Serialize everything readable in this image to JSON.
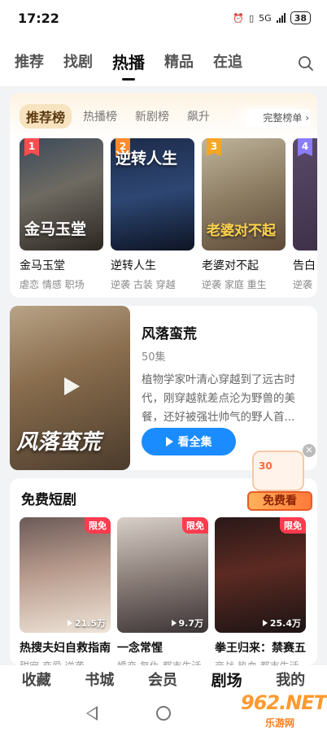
{
  "status_bar": {
    "time": "17:22",
    "network": "5G",
    "battery": "38"
  },
  "top_tabs": [
    {
      "label": "推荐",
      "active": false
    },
    {
      "label": "找剧",
      "active": false
    },
    {
      "label": "热播",
      "active": true
    },
    {
      "label": "精品",
      "active": false
    },
    {
      "label": "在追",
      "active": false
    }
  ],
  "ranking": {
    "title": "推荐榜",
    "subtabs": [
      "热播榜",
      "新剧榜",
      "飙升"
    ],
    "more": "完整榜单",
    "items": [
      {
        "rank": "1",
        "poster_text": "金马玉堂",
        "name": "金马玉堂",
        "tags": "虐恋 情感 职场",
        "badge_color": "#ff4d4f",
        "poster_bg": "linear-gradient(160deg,#3c4a5a 0%,#6e6a62 45%,#2c2620 100%)"
      },
      {
        "rank": "2",
        "poster_text": "逆转人生",
        "name": "逆转人生",
        "tags": "逆袭 古装 穿越",
        "badge_color": "#ff8a2a",
        "poster_bg": "linear-gradient(170deg,#1d2b4a 0%,#2d4773 50%,#0e1424 100%)"
      },
      {
        "rank": "3",
        "poster_text": "老婆对不起",
        "name": "老婆对不起",
        "tags": "逆袭 家庭 重生",
        "badge_color": "#f5a623",
        "poster_bg": "linear-gradient(160deg,#bfb59c 0%,#8c7c62 50%,#5d4a38 100%)"
      },
      {
        "rank": "4",
        "poster_text": "",
        "name": "告白",
        "tags": "逆袭",
        "badge_color": "#8a7cff",
        "poster_bg": "linear-gradient(160deg,#5a4a6a 0%,#3a2c44 100%)"
      }
    ]
  },
  "featured": {
    "poster_text": "风落蛮荒",
    "title": "风落蛮荒",
    "episodes": "50集",
    "description": "植物学家叶清心穿越到了远古时代，刚穿越就差点沦为野兽的美餐，还好被强壮帅气的野人首...",
    "button": "看全集"
  },
  "promo": {
    "amount": "30",
    "label": "免费看"
  },
  "free_section": {
    "title": "免费短剧",
    "items": [
      {
        "badge": "限免",
        "views": "21.5万",
        "name": "热搜夫妇自救指南",
        "sub": "甜宠 恋爱 逆袭",
        "poster_bg": "linear-gradient(170deg,#6c5a58 0%,#b79a8c 45%,#efe4d8 100%)"
      },
      {
        "badge": "限免",
        "views": "9.7万",
        "name": "一念常惺",
        "sub": "婚恋 复仇 都市生活",
        "poster_bg": "linear-gradient(170deg,#d8cfc8 0%,#8a7d78 50%,#3c3436 100%)"
      },
      {
        "badge": "限免",
        "views": "25.4万",
        "name": "拳王归来：禁赛五年的逆袭",
        "sub": "商战 热血 都市生活",
        "poster_bg": "linear-gradient(170deg,#2a1818 0%,#5c2a22 45%,#1c1414 100%)"
      }
    ]
  },
  "bottom_nav": [
    {
      "label": "收藏",
      "active": false
    },
    {
      "label": "书城",
      "active": false
    },
    {
      "label": "会员",
      "active": false
    },
    {
      "label": "剧场",
      "active": true
    },
    {
      "label": "我的",
      "active": false
    }
  ],
  "watermark": {
    "text": "962.NET",
    "sub": "乐游网"
  }
}
